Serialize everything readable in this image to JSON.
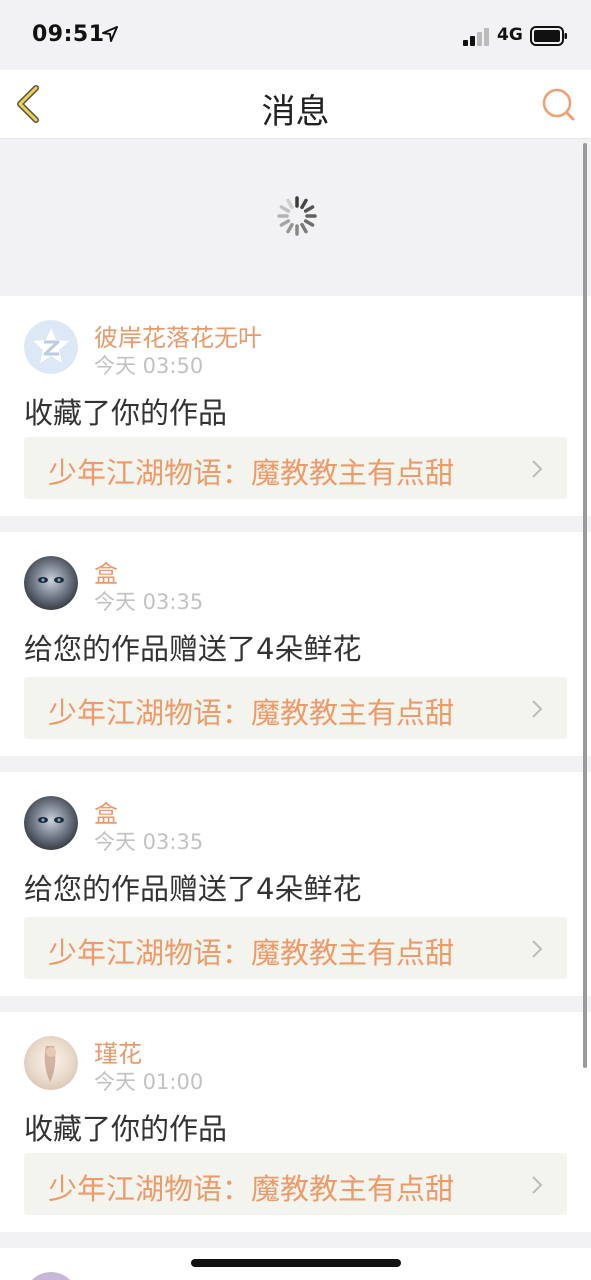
{
  "status_bar": {
    "time": "09:51",
    "network": "4G"
  },
  "nav": {
    "title": "消息"
  },
  "colors": {
    "accent": "#e89a6b",
    "work_link_bg": "#f4f4ee",
    "back_arrow": "#f2d44a"
  },
  "messages": [
    {
      "username": "彼岸花落花无叶",
      "time": "今天 03:50",
      "action": "收藏了你的作品",
      "work": "少年江湖物语：魔教教主有点甜",
      "avatar_icon": "default-avatar-icon"
    },
    {
      "username": "盒",
      "time": "今天 03:35",
      "action": "给您的作品赠送了4朵鲜花",
      "work": "少年江湖物语：魔教教主有点甜",
      "avatar_icon": "user-photo-avatar"
    },
    {
      "username": "盒",
      "time": "今天 03:35",
      "action": "给您的作品赠送了4朵鲜花",
      "work": "少年江湖物语：魔教教主有点甜",
      "avatar_icon": "user-photo-avatar"
    },
    {
      "username": "瑾花",
      "time": "今天 01:00",
      "action": "收藏了你的作品",
      "work": "少年江湖物语：魔教教主有点甜",
      "avatar_icon": "user-photo-avatar"
    }
  ]
}
